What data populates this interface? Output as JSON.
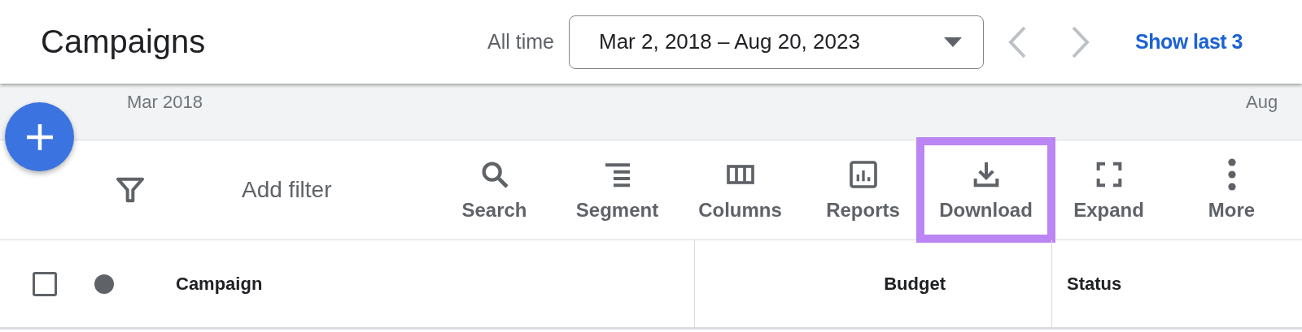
{
  "header": {
    "title": "Campaigns",
    "range_label": "All time",
    "date_range": "Mar 2, 2018 – Aug 20, 2023",
    "prev_disabled": true,
    "next_disabled": true,
    "show_last": "Show last 3"
  },
  "timeline": {
    "start": "Mar 2018",
    "end": "Aug"
  },
  "toolbar": {
    "filter_label": "Add filter",
    "buttons": [
      {
        "kind": "search",
        "label": "Search",
        "highlighted": false
      },
      {
        "kind": "segment",
        "label": "Segment",
        "highlighted": false
      },
      {
        "kind": "columns",
        "label": "Columns",
        "highlighted": false
      },
      {
        "kind": "reports",
        "label": "Reports",
        "highlighted": false
      },
      {
        "kind": "download",
        "label": "Download",
        "highlighted": true
      },
      {
        "kind": "expand",
        "label": "Expand",
        "highlighted": false
      },
      {
        "kind": "more",
        "label": "More",
        "highlighted": false
      }
    ]
  },
  "table": {
    "select_all_checked": false,
    "columns": [
      "Campaign",
      "Budget",
      "Status"
    ]
  }
}
